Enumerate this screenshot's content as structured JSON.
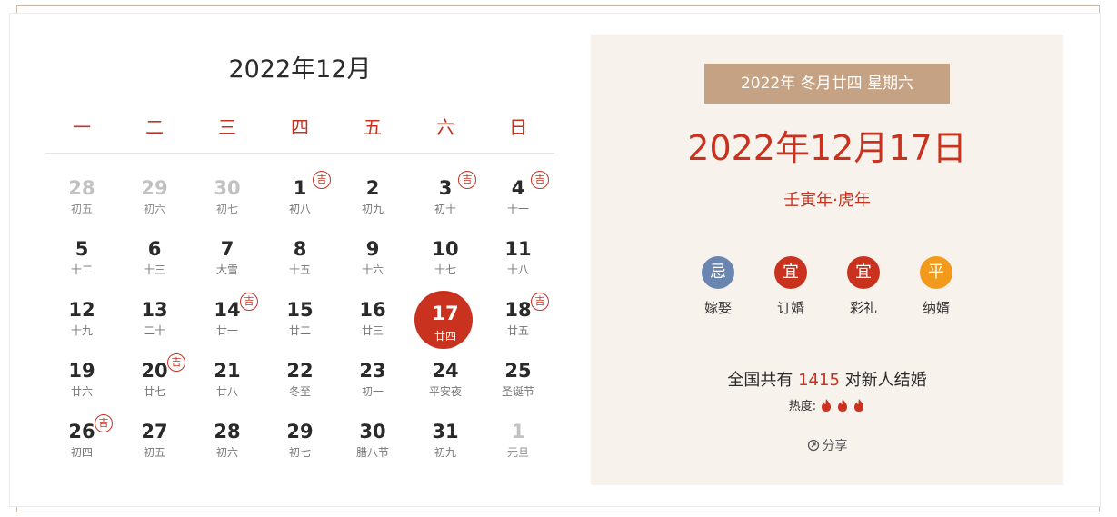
{
  "calendar": {
    "title": "2022年12月",
    "weekdays": [
      "一",
      "二",
      "三",
      "四",
      "五",
      "六",
      "日"
    ],
    "ji_label": "吉",
    "weeks": [
      [
        {
          "day": "28",
          "lunar": "初五",
          "other": true
        },
        {
          "day": "29",
          "lunar": "初六",
          "other": true
        },
        {
          "day": "30",
          "lunar": "初七",
          "other": true
        },
        {
          "day": "1",
          "lunar": "初八",
          "ji": true
        },
        {
          "day": "2",
          "lunar": "初九"
        },
        {
          "day": "3",
          "lunar": "初十",
          "ji": true
        },
        {
          "day": "4",
          "lunar": "十一",
          "ji": true
        }
      ],
      [
        {
          "day": "5",
          "lunar": "十二"
        },
        {
          "day": "6",
          "lunar": "十三"
        },
        {
          "day": "7",
          "lunar": "大雪"
        },
        {
          "day": "8",
          "lunar": "十五"
        },
        {
          "day": "9",
          "lunar": "十六"
        },
        {
          "day": "10",
          "lunar": "十七"
        },
        {
          "day": "11",
          "lunar": "十八"
        }
      ],
      [
        {
          "day": "12",
          "lunar": "十九"
        },
        {
          "day": "13",
          "lunar": "二十"
        },
        {
          "day": "14",
          "lunar": "廿一",
          "ji": true
        },
        {
          "day": "15",
          "lunar": "廿二"
        },
        {
          "day": "16",
          "lunar": "廿三"
        },
        {
          "day": "17",
          "lunar": "廿四",
          "selected": true
        },
        {
          "day": "18",
          "lunar": "廿五",
          "ji": true
        }
      ],
      [
        {
          "day": "19",
          "lunar": "廿六"
        },
        {
          "day": "20",
          "lunar": "廿七",
          "ji": true
        },
        {
          "day": "21",
          "lunar": "廿八"
        },
        {
          "day": "22",
          "lunar": "冬至"
        },
        {
          "day": "23",
          "lunar": "初一"
        },
        {
          "day": "24",
          "lunar": "平安夜"
        },
        {
          "day": "25",
          "lunar": "圣诞节"
        }
      ],
      [
        {
          "day": "26",
          "lunar": "初四",
          "ji": true
        },
        {
          "day": "27",
          "lunar": "初五"
        },
        {
          "day": "28",
          "lunar": "初六"
        },
        {
          "day": "29",
          "lunar": "初七"
        },
        {
          "day": "30",
          "lunar": "腊八节"
        },
        {
          "day": "31",
          "lunar": "初九"
        },
        {
          "day": "1",
          "lunar": "元旦",
          "other": true
        }
      ]
    ]
  },
  "detail": {
    "lunar_banner": "2022年 冬月廿四 星期六",
    "date": "2022年12月17日",
    "ganzhi": "壬寅年·虎年",
    "advice": [
      {
        "badge": "忌",
        "label": "嫁娶",
        "color": "#6a85b0"
      },
      {
        "badge": "宜",
        "label": "订婚",
        "color": "#c8321f"
      },
      {
        "badge": "宜",
        "label": "彩礼",
        "color": "#c8321f"
      },
      {
        "badge": "平",
        "label": "纳婿",
        "color": "#f39a1c"
      }
    ],
    "marry_prefix": "全国共有 ",
    "marry_count": "1415",
    "marry_suffix": " 对新人结婚",
    "heat_label": "热度:",
    "heat_level": 3,
    "share_label": "分享"
  },
  "colors": {
    "accent": "#c8321f",
    "banner": "#c4a283",
    "panel_bg": "#f8f2ed"
  }
}
